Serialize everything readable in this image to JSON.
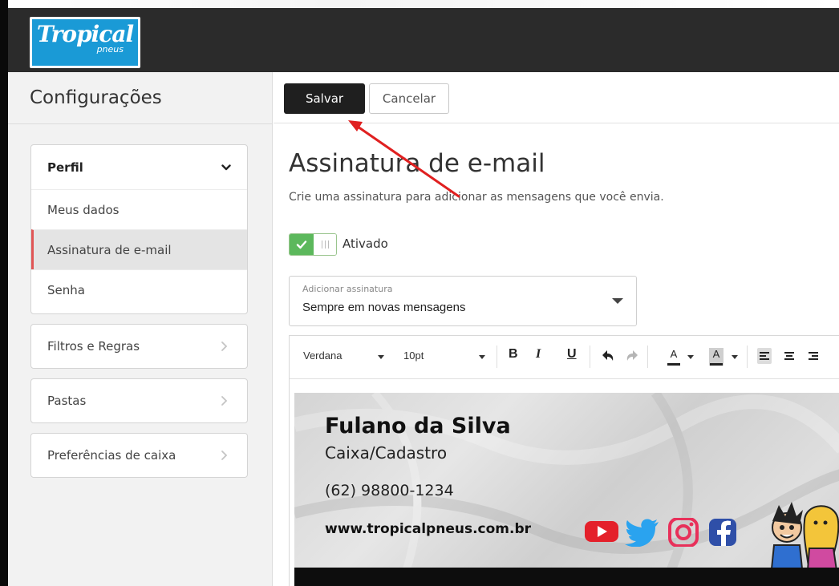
{
  "brand": {
    "logo_line1": "Tropical",
    "logo_line2": "pneus",
    "logo_color": "#1a9ad6",
    "topbar_color": "#2b2b2b"
  },
  "sidebar": {
    "title": "Configurações",
    "groups": [
      {
        "label": "Perfil",
        "expanded": true,
        "items": [
          {
            "label": "Meus dados",
            "active": false
          },
          {
            "label": "Assinatura de e-mail",
            "active": true
          },
          {
            "label": "Senha",
            "active": false
          }
        ]
      },
      {
        "label": "Filtros e Regras",
        "expanded": false
      },
      {
        "label": "Pastas",
        "expanded": false
      },
      {
        "label": "Preferências de caixa",
        "expanded": false
      }
    ],
    "active_accent": "#e05555"
  },
  "toolbar": {
    "save_label": "Salvar",
    "cancel_label": "Cancelar"
  },
  "main": {
    "title": "Assinatura de e-mail",
    "description": "Crie uma assinatura para adicionar as mensagens que você envia.",
    "toggle": {
      "label": "Ativado",
      "on": true,
      "on_color": "#5cb85c"
    },
    "select": {
      "label": "Adicionar assinatura",
      "value": "Sempre em novas mensagens"
    }
  },
  "editor": {
    "font_family": "Verdana",
    "font_size": "10pt",
    "bold": "B",
    "italic": "I",
    "underline": "U",
    "text_color_glyph": "A",
    "bg_color_glyph": "A"
  },
  "signature": {
    "name": "Fulano da Silva",
    "role": "Caixa/Cadastro",
    "phone": "(62) 98800-1234",
    "website": "www.tropicalpneus.com.br",
    "social_icons": [
      "youtube-icon",
      "twitter-icon",
      "instagram-icon",
      "facebook-icon"
    ]
  },
  "annotation": {
    "arrow_color": "#e02020"
  }
}
